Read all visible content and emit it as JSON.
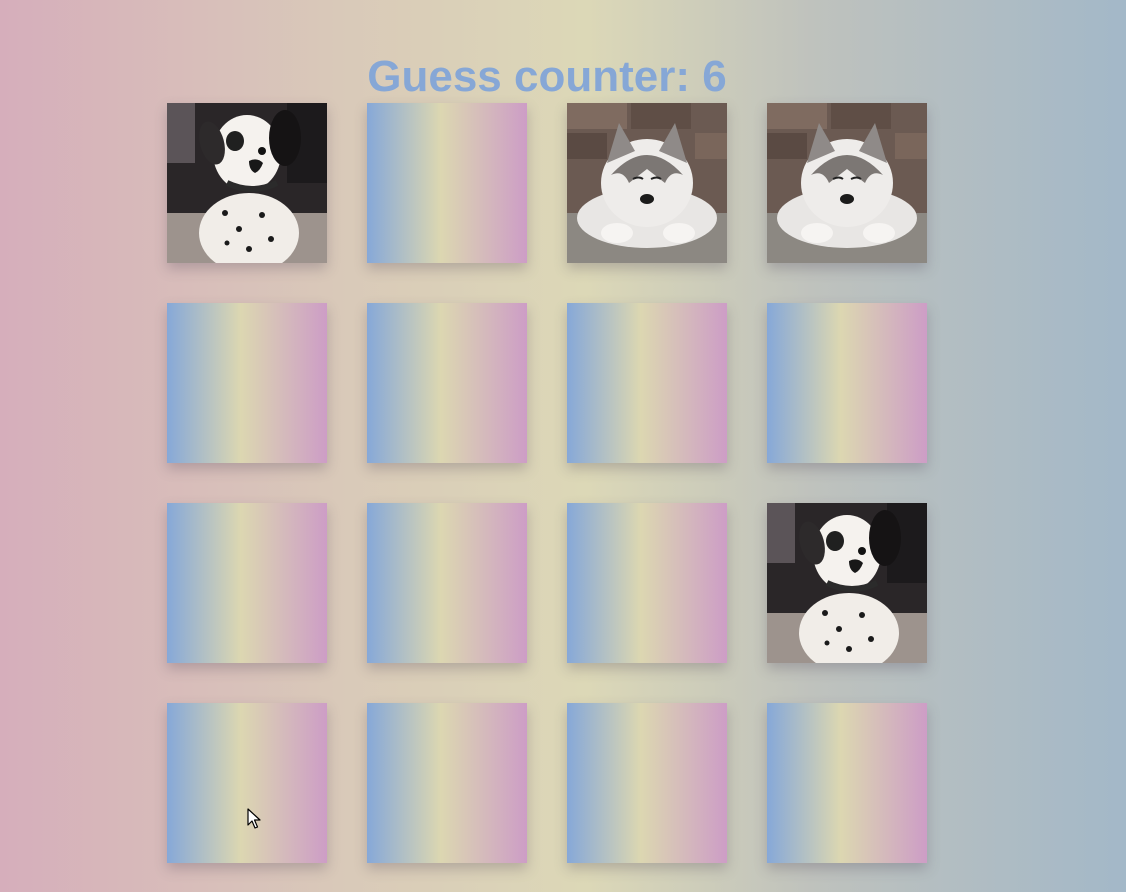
{
  "title": {
    "label": "Guess counter:",
    "count": "6"
  },
  "colors": {
    "title": "#86a7d6",
    "card_back_left": "#86a8d8",
    "card_back_mid": "#dcd7b1",
    "card_back_right": "#cd9dc6"
  },
  "cards": [
    {
      "state": "face-up",
      "image": "dalmatian-puppy"
    },
    {
      "state": "face-down"
    },
    {
      "state": "face-up",
      "image": "husky-puppy"
    },
    {
      "state": "face-up",
      "image": "husky-puppy"
    },
    {
      "state": "face-down"
    },
    {
      "state": "face-down"
    },
    {
      "state": "face-down"
    },
    {
      "state": "face-down"
    },
    {
      "state": "face-down"
    },
    {
      "state": "face-down"
    },
    {
      "state": "face-down"
    },
    {
      "state": "face-up",
      "image": "dalmatian-puppy"
    },
    {
      "state": "face-down"
    },
    {
      "state": "face-down"
    },
    {
      "state": "face-down"
    },
    {
      "state": "face-down"
    }
  ]
}
